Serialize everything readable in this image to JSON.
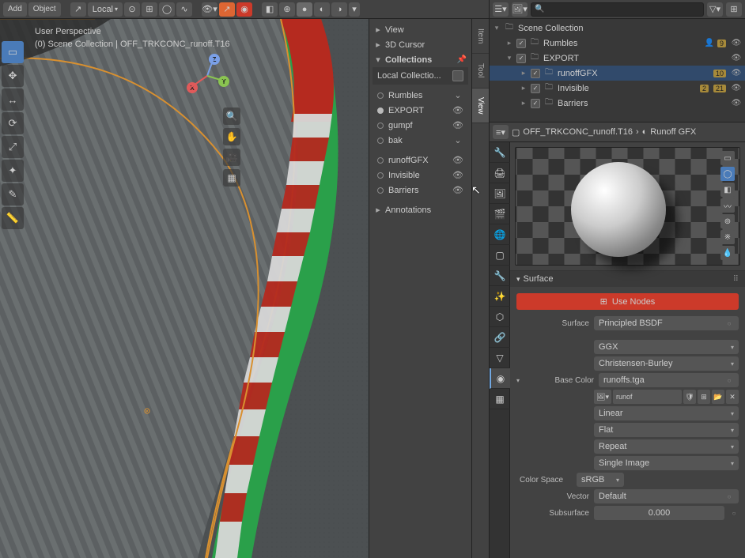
{
  "viewport": {
    "toolbar": {
      "add": "Add",
      "object": "Object",
      "orientation": "Local"
    },
    "overlay": {
      "line1": "User Perspective",
      "line2": "(0) Scene Collection | OFF_TRKCONC_runoff.T16"
    },
    "side_tabs": [
      "Item",
      "Tool",
      "View"
    ],
    "panel": {
      "view": "View",
      "cursor": "3D Cursor",
      "collections": "Collections",
      "local_collections": "Local Collectio...",
      "list": [
        {
          "name": "Rumbles",
          "eye": false
        },
        {
          "name": "EXPORT",
          "eye": true
        },
        {
          "name": "gumpf",
          "eye": true
        },
        {
          "name": "bak",
          "eye": false
        }
      ],
      "sub_list": [
        {
          "name": "runoffGFX",
          "eye": true
        },
        {
          "name": "Invisible",
          "eye": true
        },
        {
          "name": "Barriers",
          "eye": true
        }
      ],
      "annotations": "Annotations"
    }
  },
  "outliner": {
    "search_placeholder": "",
    "root": "Scene Collection",
    "items": [
      {
        "name": "Rumbles",
        "indent": 1,
        "checked": true,
        "badges": [
          "9"
        ]
      },
      {
        "name": "EXPORT",
        "indent": 1,
        "checked": true,
        "badges": [],
        "expanded": true
      },
      {
        "name": "runoffGFX",
        "indent": 2,
        "checked": true,
        "badges": [
          "10"
        ],
        "selected": true
      },
      {
        "name": "Invisible",
        "indent": 2,
        "checked": true,
        "badges": [
          "2",
          "21"
        ]
      },
      {
        "name": "Barriers",
        "indent": 2,
        "checked": true,
        "badges": []
      }
    ]
  },
  "properties": {
    "breadcrumb_obj": "OFF_TRKCONC_runoff.T16",
    "breadcrumb_mat": "Runoff GFX",
    "surface_section": "Surface",
    "use_nodes": "Use Nodes",
    "fields": {
      "surface_label": "Surface",
      "surface_value": "Principled BSDF",
      "distribution": "GGX",
      "subsurface_method": "Christensen-Burley",
      "base_color_label": "Base Color",
      "base_color_value": "runoffs.tga",
      "tex_name": "runof",
      "interpolation": "Linear",
      "projection": "Flat",
      "extension": "Repeat",
      "source": "Single Image",
      "colorspace_label": "Color Space",
      "colorspace_value": "sRGB",
      "vector_label": "Vector",
      "vector_value": "Default",
      "subsurface_label": "Subsurface",
      "subsurface_value": "0.000"
    }
  },
  "colors": {
    "accent_red": "#cc3a2a",
    "green": "#2aa04a",
    "kerb_red": "#b52a1f",
    "kerb_white": "#d8d8d8",
    "orange_line": "#d89030"
  }
}
